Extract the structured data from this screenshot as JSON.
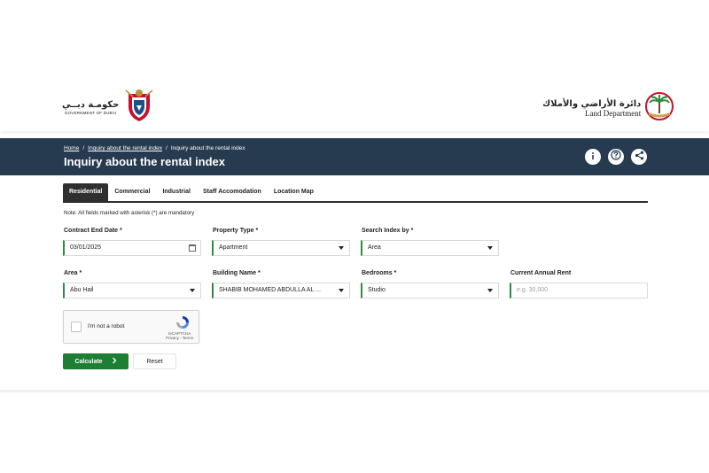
{
  "header": {
    "gov_logo_arabic": "حكومـة دبــي",
    "gov_logo_english": "GOVERNMENT OF DUBAI",
    "dld_logo_arabic": "دائرة الأراضي والأملاك",
    "dld_logo_english": "Land Department"
  },
  "banner": {
    "breadcrumb": [
      "Home",
      "Inquiry about the rental index",
      "Inquiry about the rental index"
    ],
    "separator": "/",
    "title": "Inquiry about the rental index",
    "bg_color": "#263a50"
  },
  "tabs": [
    {
      "label": "Residential",
      "active": true
    },
    {
      "label": "Commercial",
      "active": false
    },
    {
      "label": "Industrial",
      "active": false
    },
    {
      "label": "Staff Accomodation",
      "active": false
    },
    {
      "label": "Location Map",
      "active": false
    }
  ],
  "form": {
    "note": "Note: All fields marked with asterisk (*) are mandatory",
    "contract_end_date": {
      "label": "Contract End Date *",
      "value": "03/01/2025"
    },
    "property_type": {
      "label": "Property Type *",
      "value": "Apartment"
    },
    "search_index_by": {
      "label": "Search Index by *",
      "value": "Area"
    },
    "area": {
      "label": "Area *",
      "value": "Abu Hail"
    },
    "building_name": {
      "label": "Building Name *",
      "value": "SHABIB MOHAMED ABDULLA AL ..."
    },
    "bedrooms": {
      "label": "Bedrooms *",
      "value": "Studio"
    },
    "current_annual_rent": {
      "label": "Current Annual Rent",
      "value": "",
      "placeholder": "e.g. 30,000"
    },
    "accent_color": "#2e8b3e"
  },
  "captcha": {
    "label": "I'm not a robot",
    "brand": "reCAPTCHA",
    "links": "Privacy - Terms"
  },
  "actions": {
    "calculate": "Calculate",
    "calculate_icon": "chevron-right-icon",
    "reset": "Reset",
    "calculate_color": "#1e7e34"
  }
}
